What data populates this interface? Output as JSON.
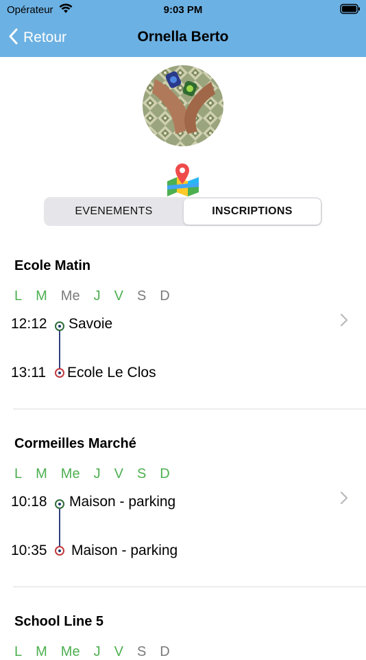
{
  "status_bar": {
    "carrier": "Opérateur",
    "time": "9:03 PM"
  },
  "nav": {
    "back_label": "Retour",
    "title": "Ornella Berto"
  },
  "tabs": [
    {
      "label": "EVENEMENTS",
      "selected": false
    },
    {
      "label": "INSCRIPTIONS",
      "selected": true
    }
  ],
  "colors": {
    "nav_bar": "#6cb1e3",
    "day_active": "#4caf50",
    "day_inactive": "#7a7a7a",
    "route_line": "#2e3f7f"
  },
  "routes": [
    {
      "name": "Ecole Matin",
      "days": [
        {
          "label": "L",
          "active": true
        },
        {
          "label": "M",
          "active": true
        },
        {
          "label": "Me",
          "active": false
        },
        {
          "label": "J",
          "active": true
        },
        {
          "label": "V",
          "active": true
        },
        {
          "label": "S",
          "active": false
        },
        {
          "label": "D",
          "active": false
        }
      ],
      "start": {
        "time": "12:12",
        "place": "Savoie"
      },
      "end": {
        "time": "13:11",
        "place": "Ecole Le Clos"
      }
    },
    {
      "name": "Cormeilles Marché",
      "days": [
        {
          "label": "L",
          "active": true
        },
        {
          "label": "M",
          "active": true
        },
        {
          "label": "Me",
          "active": true
        },
        {
          "label": "J",
          "active": true
        },
        {
          "label": "V",
          "active": true
        },
        {
          "label": "S",
          "active": true
        },
        {
          "label": "D",
          "active": true
        }
      ],
      "start": {
        "time": "10:18",
        "place": "Maison - parking"
      },
      "end": {
        "time": "10:35",
        "place": "Maison - parking"
      }
    },
    {
      "name": "School Line 5",
      "days": [
        {
          "label": "L",
          "active": true
        },
        {
          "label": "M",
          "active": true
        },
        {
          "label": "Me",
          "active": true
        },
        {
          "label": "J",
          "active": true
        },
        {
          "label": "V",
          "active": true
        },
        {
          "label": "S",
          "active": false
        },
        {
          "label": "D",
          "active": false
        }
      ]
    }
  ]
}
